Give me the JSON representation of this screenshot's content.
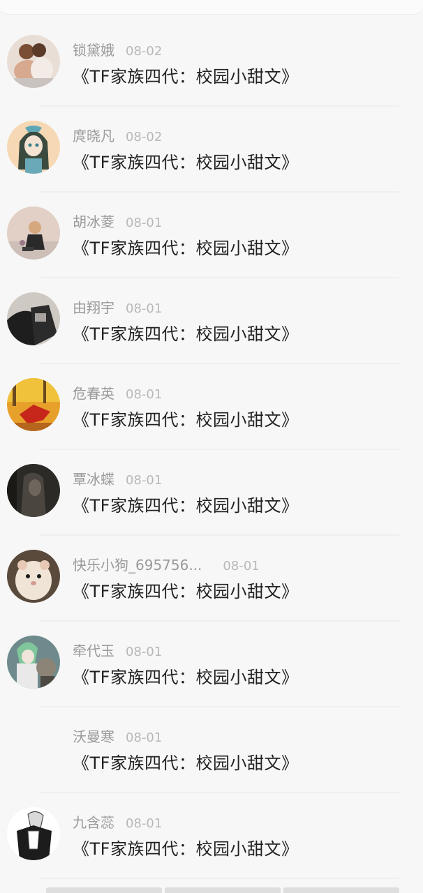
{
  "comments": [
    {
      "name": "锁黛娥",
      "date": "08-02",
      "title": "《TF家族四代：校园小甜文》",
      "avatar": "couple-photo"
    },
    {
      "name": "庹晓凡",
      "date": "08-02",
      "title": "《TF家族四代：校园小甜文》",
      "avatar": "anime-girl"
    },
    {
      "name": "胡冰菱",
      "date": "08-01",
      "title": "《TF家族四代：校园小甜文》",
      "avatar": "girl-sitting"
    },
    {
      "name": "由翔宇",
      "date": "08-01",
      "title": "《TF家族四代：校园小甜文》",
      "avatar": "dark-photo"
    },
    {
      "name": "危春英",
      "date": "08-01",
      "title": "《TF家族四代：校园小甜文》",
      "avatar": "autumn-leaf"
    },
    {
      "name": "覃冰蝶",
      "date": "08-01",
      "title": "《TF家族四代：校园小甜文》",
      "avatar": "dark-portrait"
    },
    {
      "name": "快乐小狗_695756...",
      "date": "08-01",
      "title": "《TF家族四代：校园小甜文》",
      "avatar": "hamster"
    },
    {
      "name": "牵代玉",
      "date": "08-01",
      "title": "《TF家族四代：校园小甜文》",
      "avatar": "anime-character"
    },
    {
      "name": "沃曼寒",
      "date": "08-01",
      "title": "《TF家族四代：校园小甜文》",
      "avatar": "none"
    },
    {
      "name": "九含蕊",
      "date": "08-01",
      "title": "《TF家族四代：校园小甜文》",
      "avatar": "sketch-figure"
    }
  ]
}
